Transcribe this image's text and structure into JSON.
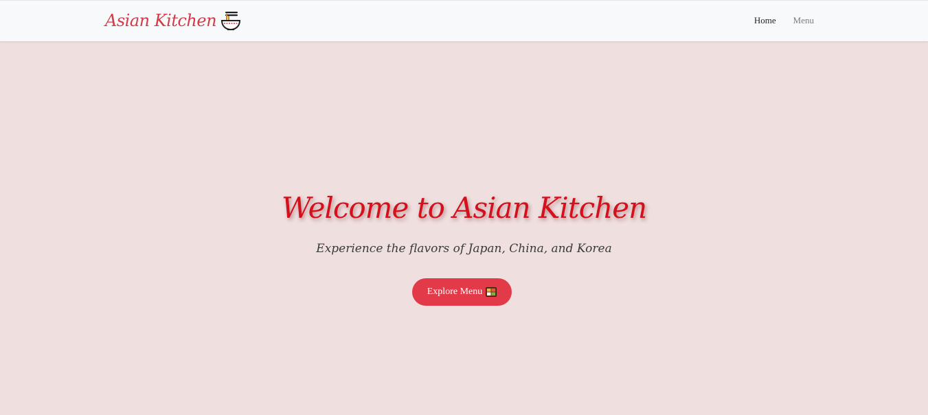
{
  "navbar": {
    "brand": {
      "text": "Asian Kitchen",
      "icon": "noodle-bowl-icon"
    },
    "links": [
      {
        "label": "Home",
        "active": true
      },
      {
        "label": "Menu",
        "active": false
      }
    ]
  },
  "hero": {
    "title": "Welcome to Asian Kitchen",
    "subtitle": "Experience the flavors of Japan, China, and Korea",
    "button": {
      "label": "Explore Menu",
      "icon": "bento-box-icon"
    }
  },
  "colors": {
    "brand": "#d23b48",
    "title": "#d3101b",
    "button": "#e23a49",
    "background": "#efdfdf",
    "navbar": "#f8f9fa"
  }
}
